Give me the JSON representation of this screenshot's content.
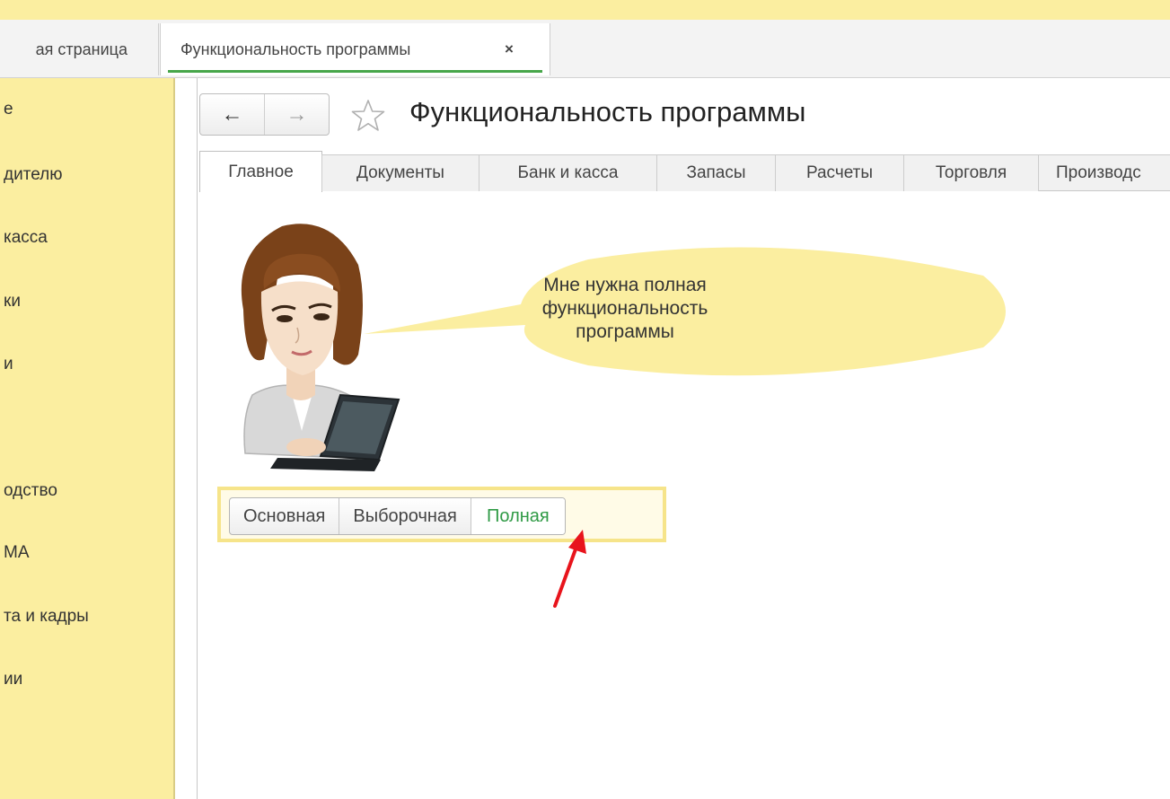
{
  "window_tabs": {
    "home_label": "ая страница",
    "active_label": "Функциональность программы",
    "close_glyph": "×"
  },
  "sidebar": {
    "items": [
      {
        "label": "е"
      },
      {
        "label": "дителю"
      },
      {
        "label": "касса"
      },
      {
        "label": "ки"
      },
      {
        "label": "и"
      },
      {
        "label": "одство"
      },
      {
        "label": "МА"
      },
      {
        "label": "та и кадры"
      },
      {
        "label": "ии"
      }
    ]
  },
  "nav": {
    "back_glyph": "←",
    "forward_glyph": "→",
    "favorite_icon": "star-outline-icon"
  },
  "page": {
    "title": "Функциональность программы"
  },
  "section_tabs": [
    {
      "label": "Главное",
      "active": true
    },
    {
      "label": "Документы"
    },
    {
      "label": "Банк и касса"
    },
    {
      "label": "Запасы"
    },
    {
      "label": "Расчеты"
    },
    {
      "label": "Торговля"
    },
    {
      "label": "Производс"
    }
  ],
  "bubble": {
    "text": "Мне нужна полная функциональность программы"
  },
  "mode_selector": {
    "options": [
      {
        "label": "Основная"
      },
      {
        "label": "Выборочная"
      },
      {
        "label": "Полная",
        "selected": true
      }
    ]
  },
  "colors": {
    "sidebar_bg": "#fbeea0",
    "accent_green": "#47a64a",
    "arrow_red": "#e8141c",
    "highlight_border": "#f6e48a"
  }
}
